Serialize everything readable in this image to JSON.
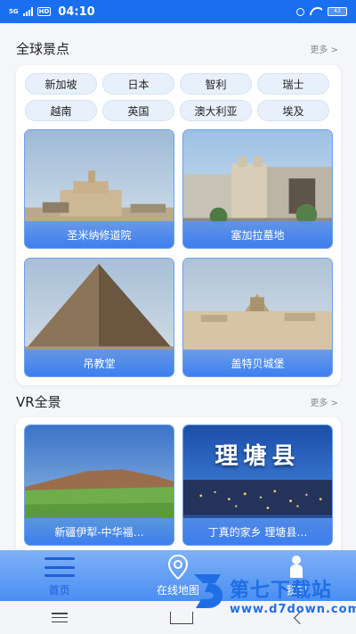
{
  "status_bar": {
    "signal_label": "5G",
    "hd": "HD",
    "time": "04:10",
    "battery": "43"
  },
  "global_section": {
    "title": "全球景点",
    "more": "更多 >",
    "chips": [
      "新加坡",
      "日本",
      "智利",
      "瑞士",
      "越南",
      "英国",
      "澳大利亚",
      "埃及"
    ],
    "tiles": [
      {
        "caption": "圣米纳修道院"
      },
      {
        "caption": "塞加拉墓地"
      },
      {
        "caption": "吊教堂"
      },
      {
        "caption": "盖特贝城堡"
      }
    ]
  },
  "vr_section": {
    "title": "VR全景",
    "more": "更多 >",
    "tiles": [
      {
        "caption": "新疆伊犁-中华福…"
      },
      {
        "caption": "丁真的家乡 理塘县…",
        "image_text": "理塘县"
      }
    ]
  },
  "bottom_nav": {
    "items": [
      {
        "label": "首页",
        "icon": "menu-icon"
      },
      {
        "label": "在线地图",
        "icon": "map-pin-icon"
      },
      {
        "label": "我的",
        "icon": "person-icon"
      }
    ]
  },
  "watermark": {
    "title": "第七下载站",
    "url": "www.d7down.com"
  },
  "colors": {
    "accent": "#1a6ff0",
    "chip_bg": "#e8f0fb",
    "caption_bg": "#3d7ff0"
  }
}
